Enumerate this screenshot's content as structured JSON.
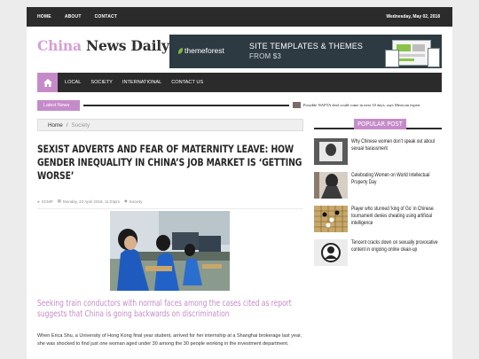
{
  "topbar": {
    "nav": [
      "HOME",
      "ABOUT",
      "CONTACT"
    ],
    "date": "Wednesday, May 02, 2018"
  },
  "logo": {
    "part1": "China",
    "part2": " News Daily"
  },
  "ad": {
    "brand": "themeforest",
    "line1": "SITE TEMPLATES & THEMES",
    "line2": "FROM $3"
  },
  "mainnav": {
    "home_icon": "home-icon",
    "items": [
      "LOCAL",
      "SOCIETY",
      "INTERNATIONAL",
      "CONTACT US"
    ]
  },
  "ticker": {
    "label": "Latest News",
    "item": "Possible NAFTA deal could come in next 10 days, says Mexican expert"
  },
  "breadcrumb": {
    "home": "Home",
    "separator": "/",
    "current": "Society"
  },
  "article": {
    "title": "SEXIST ADVERTS AND FEAR OF MATERNITY LEAVE: HOW GENDER INEQUALITY IN CHINA’S JOB MARKET IS ‘GETTING WORSE’",
    "author": "SCMP",
    "date": "Monday, 23 April 2018, 11:03pm",
    "category": "Society",
    "lede": "Seeking train conductors with normal faces among the cases cited as report suggests that China is going backwards on discrimination",
    "body": "When Erica Shu, a University of Hong Kong final year student, arrived for her internship at a Shanghai brokerage last year, she was shocked to find just one woman aged under 30 among the 30 people working in the investment department."
  },
  "sidebar": {
    "heading": "POPULAR POST",
    "posts": [
      {
        "title": "Why Chinese women don’t speak out about sexual harassment"
      },
      {
        "title": "Celebrating Women on World Intellectual Property Day"
      },
      {
        "title": "Player who stunned ‘king of Go’ in Chinese tournament denies cheating using artificial intelligence"
      },
      {
        "title": "Tencent cracks down on sexually provocative content in ongoing online clean-up"
      }
    ]
  },
  "colors": {
    "accent": "#c58bc9",
    "dark": "#2b2b2b",
    "logo_pink": "#d59fd7"
  }
}
